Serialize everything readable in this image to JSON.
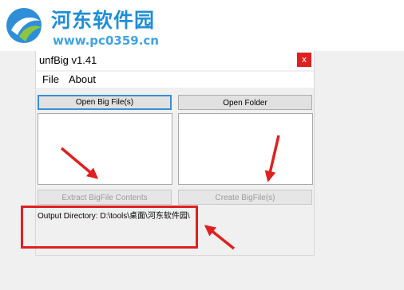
{
  "watermark": {
    "title": "河东软件园",
    "url": "www.pc0359.cn"
  },
  "window": {
    "title": "unfBig v1.41",
    "close_label": "x"
  },
  "menu": {
    "items": [
      "File",
      "About"
    ]
  },
  "buttons": {
    "open_big_files": "Open Big File(s)",
    "open_folder": "Open Folder",
    "extract_contents": "Extract BigFile Contents",
    "create_bigfiles": "Create BigFile(s)"
  },
  "output": {
    "label": "Output Directory: ",
    "path": "D:\\tools\\桌面\\河东软件园\\"
  },
  "colors": {
    "accent": "#3b8ed6",
    "annotation": "#e02020",
    "close": "#e01f1f"
  }
}
